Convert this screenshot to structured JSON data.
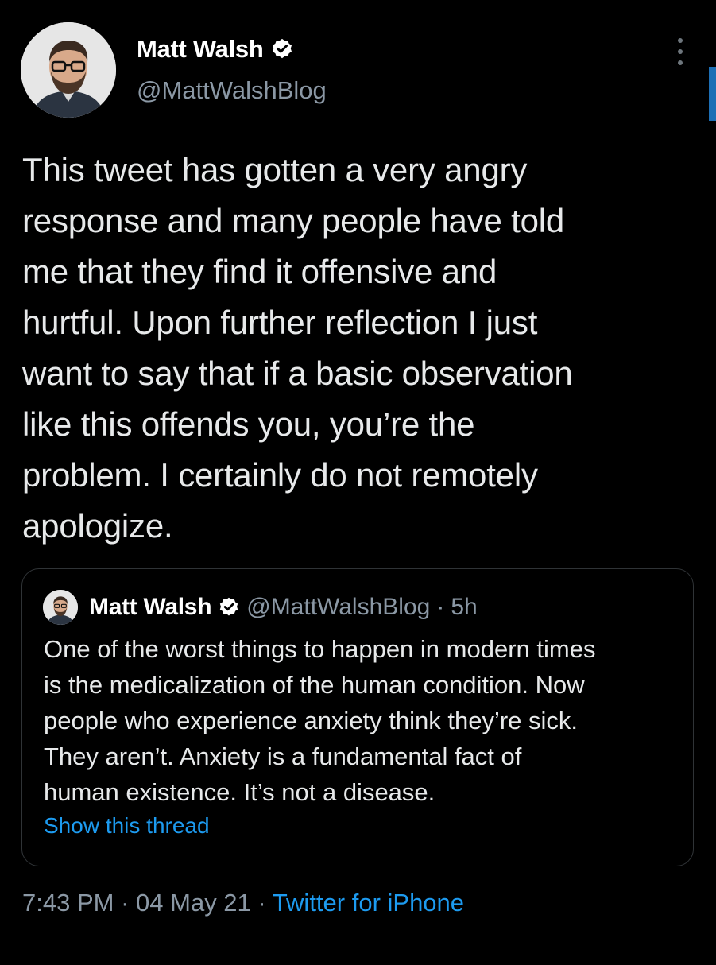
{
  "author": {
    "name": "Matt Walsh",
    "handle": "@MattWalshBlog",
    "avatar_icon": "person-avatar",
    "verified_icon": "verified-badge-icon"
  },
  "tweet": {
    "text": "This tweet has gotten a very angry\nresponse and many people have told\nme that they find it offensive and\nhurtful. Upon further reflection I just\nwant to say that if a basic observation\nlike this offends you, you’re the\nproblem. I certainly do not remotely\napologize."
  },
  "quoted_tweet": {
    "name": "Matt Walsh",
    "handle": "@MattWalshBlog",
    "separator": "·",
    "time": "5h",
    "text": "One of the worst things to happen in modern times\nis the medicalization of the human condition. Now\npeople who experience anxiety think they’re sick.\nThey aren’t. Anxiety is a fundamental fact of\nhuman existence. It’s not a disease.",
    "show_thread_label": "Show this thread"
  },
  "meta": {
    "time": "7:43 PM",
    "separator": "·",
    "date": "04 May 21",
    "source": "Twitter for iPhone"
  },
  "colors": {
    "background": "#000000",
    "text": "#e7e9ea",
    "secondary": "#8b98a5",
    "accent": "#1d9bf0",
    "border": "#2f3336"
  }
}
